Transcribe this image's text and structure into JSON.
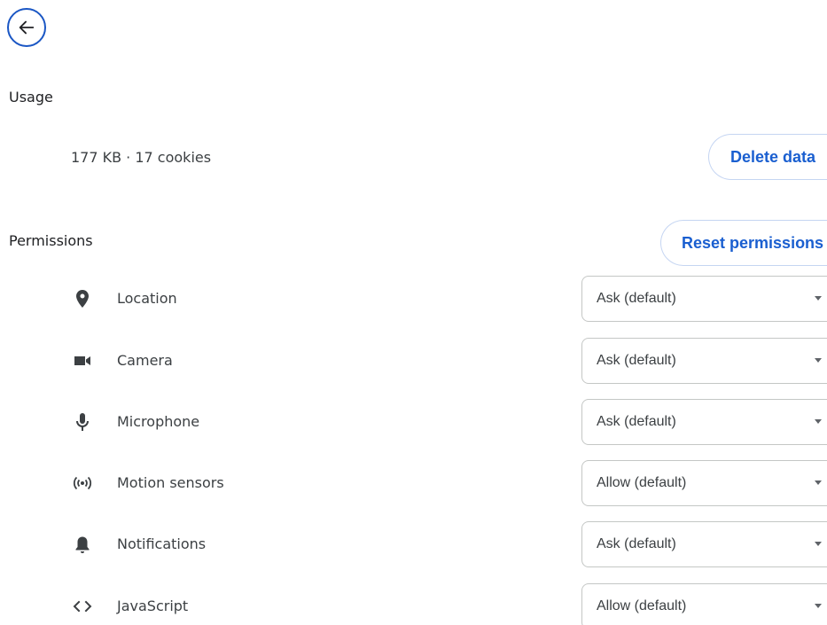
{
  "header": {
    "back_icon": "arrow-left-icon"
  },
  "usage": {
    "title": "Usage",
    "summary": "177 KB · 17 cookies",
    "delete_label": "Delete data"
  },
  "permissions": {
    "title": "Permissions",
    "reset_label": "Reset permissions",
    "items": [
      {
        "label": "Location",
        "value": "Ask (default)",
        "icon": "location-pin-icon"
      },
      {
        "label": "Camera",
        "value": "Ask (default)",
        "icon": "camera-icon"
      },
      {
        "label": "Microphone",
        "value": "Ask (default)",
        "icon": "microphone-icon"
      },
      {
        "label": "Motion sensors",
        "value": "Allow (default)",
        "icon": "motion-sensors-icon"
      },
      {
        "label": "Notifications",
        "value": "Ask (default)",
        "icon": "bell-icon"
      },
      {
        "label": "JavaScript",
        "value": "Allow (default)",
        "icon": "code-icon"
      }
    ]
  },
  "colors": {
    "accent": "#1a5fd0",
    "back_button_ring": "#1a56c4",
    "icon": "#3c4043"
  }
}
